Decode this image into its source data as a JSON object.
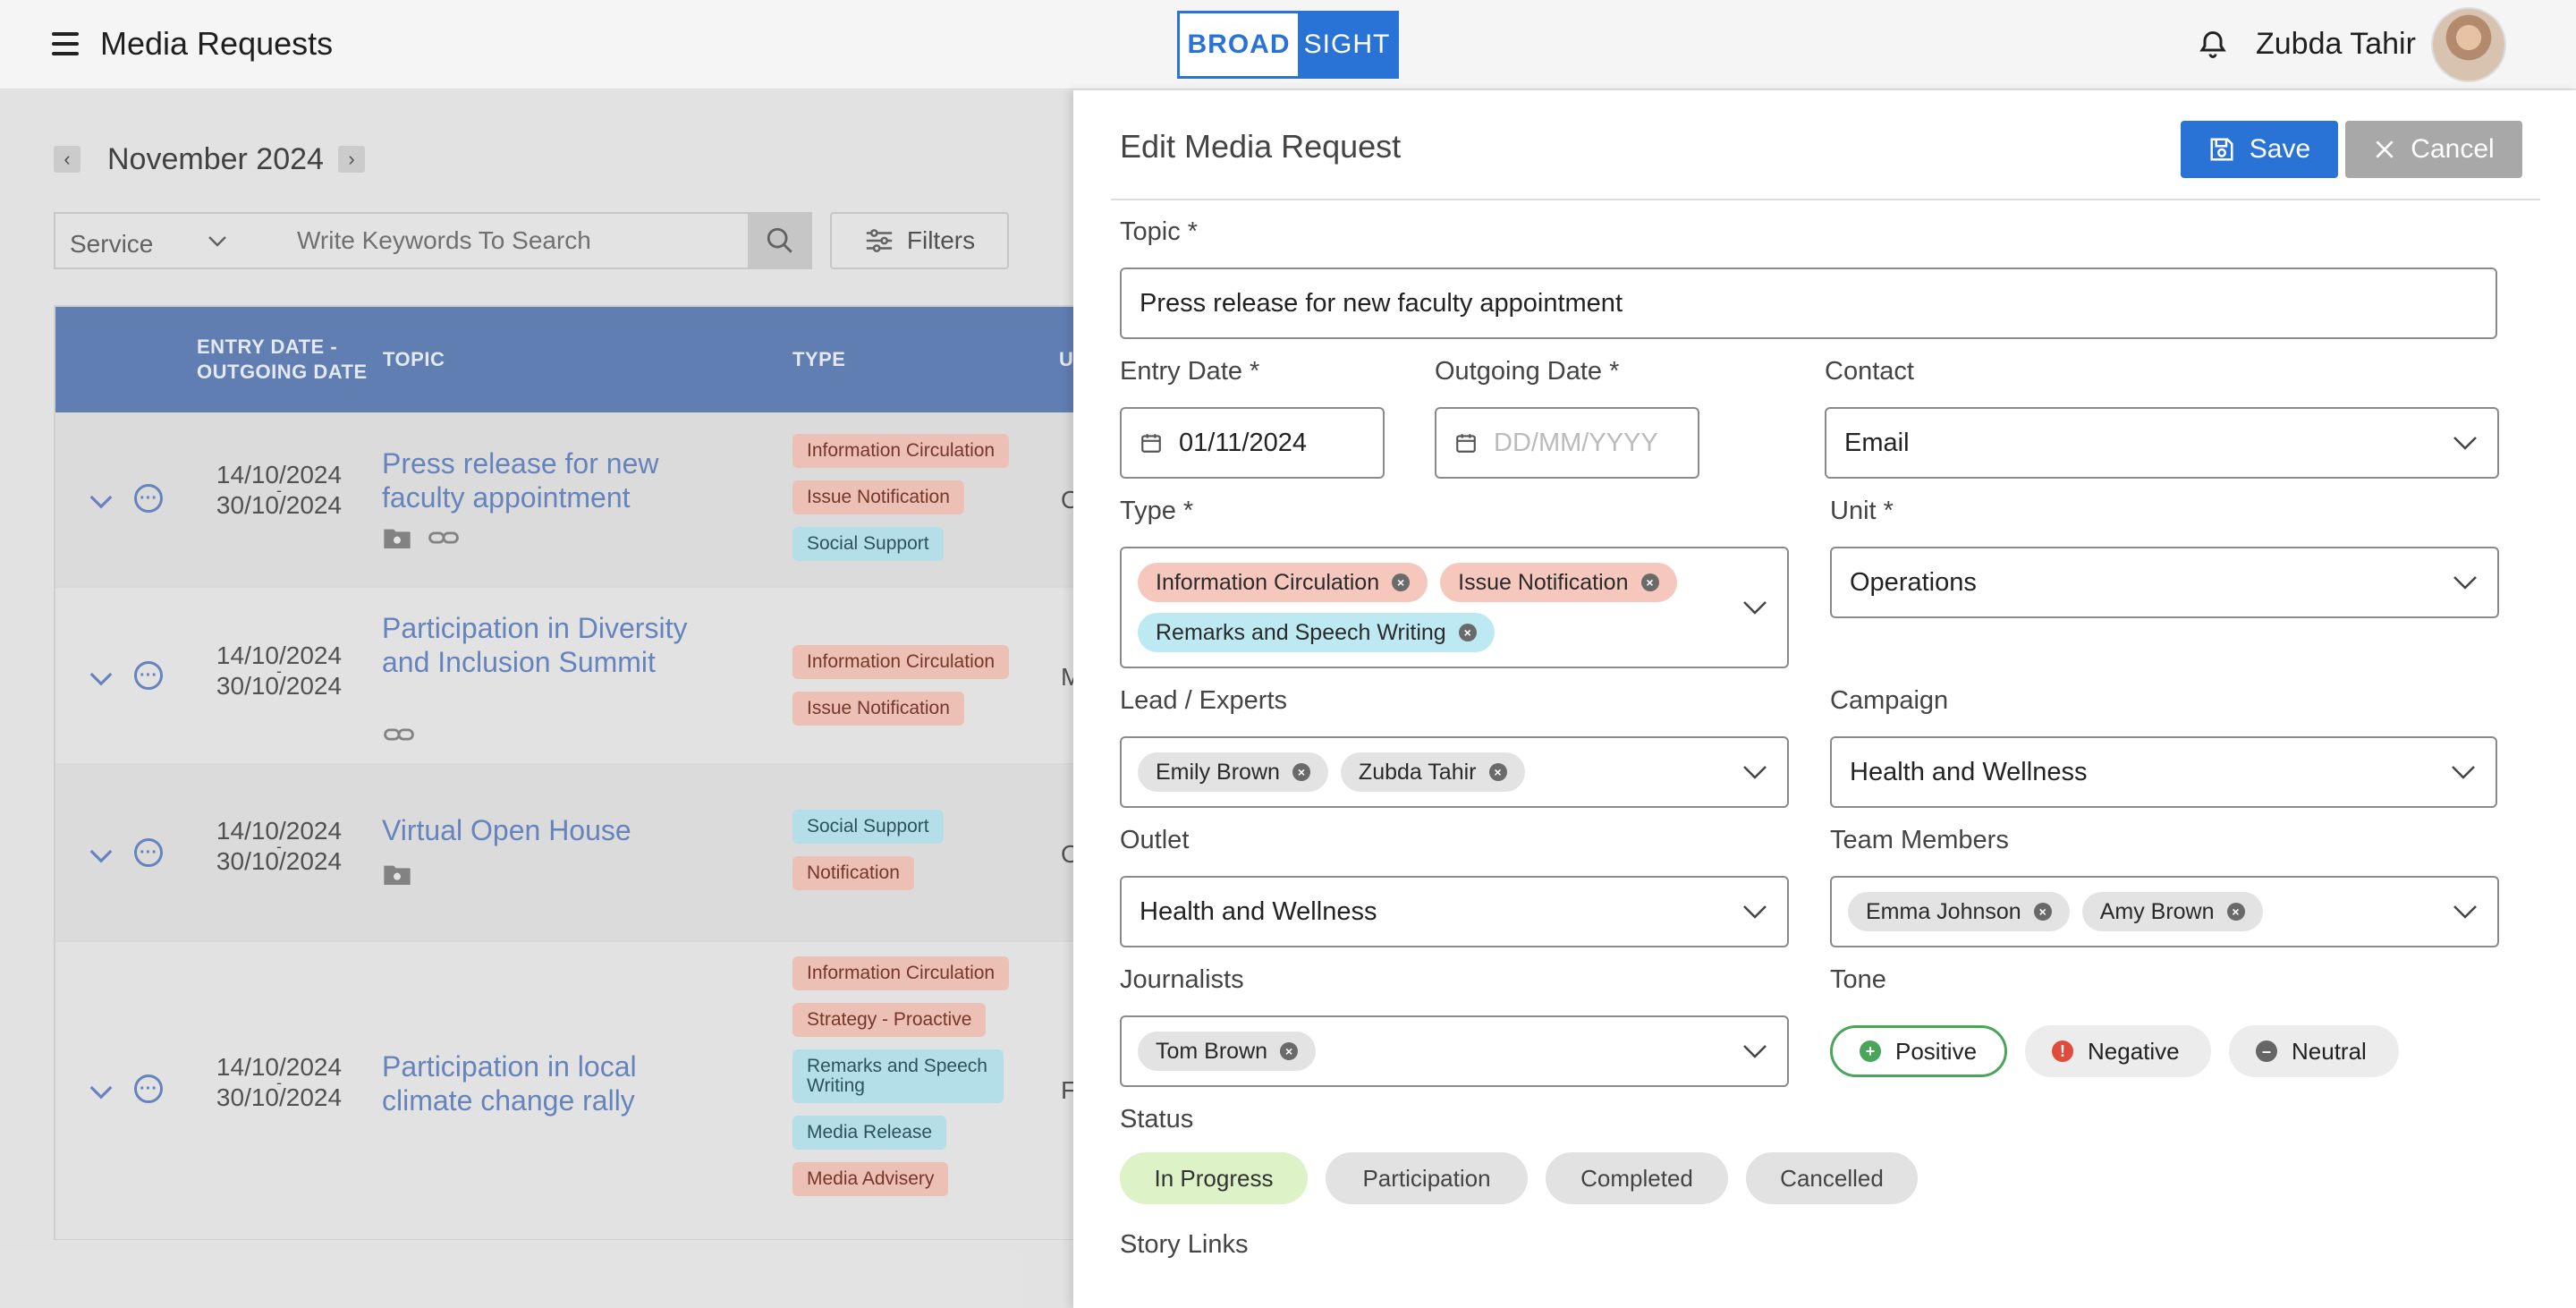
{
  "header": {
    "title": "Media Requests",
    "logo_left": "BROAD",
    "logo_right": "SIGHT",
    "user_name": "Zubda Tahir"
  },
  "list": {
    "month": "November 2024",
    "service_label": "Service",
    "search_placeholder": "Write Keywords To Search",
    "filters_label": "Filters",
    "columns": [
      "ENTRY DATE - OUTGOING DATE",
      "TOPIC",
      "TYPE",
      "U"
    ],
    "rows": [
      {
        "entry": "14/10/2024",
        "dash": "-",
        "outgoing": "30/10/2024",
        "topic": "Press release for new faculty appointment",
        "types": [
          "Information Circulation",
          "Issue Notification",
          "Social Support"
        ],
        "trunc": "O"
      },
      {
        "entry": "14/10/2024",
        "dash": "-",
        "outgoing": "30/10/2024",
        "topic": "Participation in Diversity and Inclusion Summit",
        "types": [
          "Information Circulation",
          "Issue Notification"
        ],
        "trunc": "M"
      },
      {
        "entry": "14/10/2024",
        "dash": "-",
        "outgoing": "30/10/2024",
        "topic": "Virtual Open House",
        "types": [
          "Social Support",
          "Notification"
        ],
        "trunc": "O"
      },
      {
        "entry": "14/10/2024",
        "dash": "-",
        "outgoing": "30/10/2024",
        "topic": "Participation in local climate change rally",
        "types": [
          "Information Circulation",
          "Strategy - Proactive",
          "Remarks and Speech Writing",
          "Media Release",
          "Media Advisery"
        ],
        "trunc": "F"
      }
    ]
  },
  "panel": {
    "title": "Edit Media Request",
    "save_label": "Save",
    "cancel_label": "Cancel",
    "topic_label": "Topic *",
    "topic_value": "Press release for new faculty appointment",
    "entry_date_label": "Entry Date *",
    "entry_date_value": "01/11/2024",
    "outgoing_date_label": "Outgoing Date *",
    "outgoing_date_placeholder": "DD/MM/YYYY",
    "contact_label": "Contact",
    "contact_value": "Email",
    "type_label": "Type *",
    "type_tags": [
      "Information Circulation",
      "Issue Notification",
      "Remarks and Speech Writing"
    ],
    "unit_label": "Unit *",
    "unit_value": "Operations",
    "lead_label": "Lead / Experts",
    "lead_tags": [
      "Emily Brown",
      "Zubda Tahir"
    ],
    "campaign_label": "Campaign",
    "campaign_value": "Health and Wellness",
    "outlet_label": "Outlet",
    "outlet_value": "Health and Wellness",
    "team_label": "Team Members",
    "team_tags": [
      "Emma Johnson",
      "Amy Brown"
    ],
    "journalists_label": "Journalists",
    "journalist_tags": [
      "Tom Brown"
    ],
    "tone_label": "Tone",
    "tones": [
      "Positive",
      "Negative",
      "Neutral"
    ],
    "tone_selected": "Positive",
    "status_label": "Status",
    "statuses": [
      "In Progress",
      "Participation",
      "Completed",
      "Cancelled"
    ],
    "status_selected": "In Progress",
    "story_links_label": "Story Links"
  },
  "colors": {
    "accent": "#2a73d6",
    "table_header": "#6584bb",
    "link": "#6a8ac5",
    "type_red": "#f6c8bd",
    "type_cyan": "#bde9f2",
    "tone_positive": "#4aa45a",
    "tone_negative": "#e04b3c",
    "status_selected": "#ddf2c6"
  }
}
